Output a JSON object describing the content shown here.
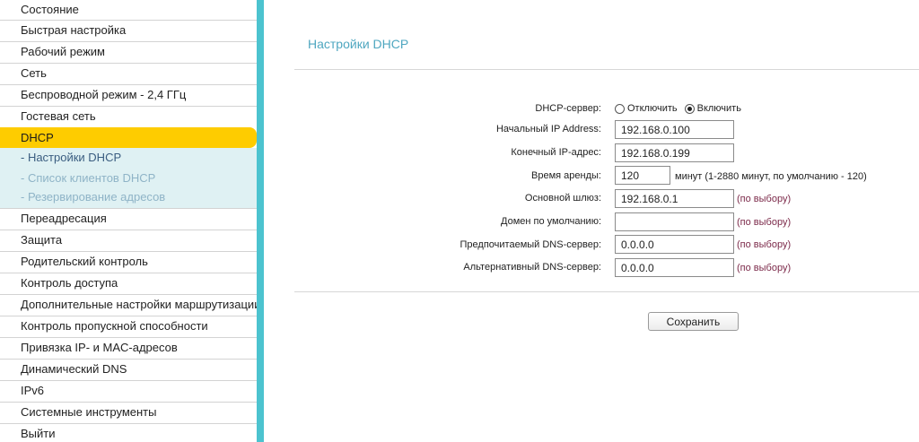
{
  "sidebar": {
    "items_top": [
      {
        "label": "Состояние"
      },
      {
        "label": "Быстрая настройка"
      },
      {
        "label": "Рабочий режим"
      },
      {
        "label": "Сеть"
      },
      {
        "label": "Беспроводной режим - 2,4 ГГц"
      },
      {
        "label": "Гостевая сеть"
      }
    ],
    "active_item": {
      "label": "DHCP"
    },
    "sub_items": [
      {
        "label": "- Настройки DHCP"
      },
      {
        "label": "- Список клиентов DHCP"
      },
      {
        "label": "- Резервирование адресов"
      }
    ],
    "items_bottom": [
      {
        "label": "Переадресация"
      },
      {
        "label": "Защита"
      },
      {
        "label": "Родительский контроль"
      },
      {
        "label": "Контроль доступа"
      },
      {
        "label": "Дополнительные настройки маршрутизации"
      },
      {
        "label": "Контроль пропускной способности"
      },
      {
        "label": "Привязка IP- и MAC-адресов"
      },
      {
        "label": "Динамический DNS"
      },
      {
        "label": "IPv6"
      },
      {
        "label": "Системные инструменты"
      },
      {
        "label": "Выйти"
      }
    ]
  },
  "main": {
    "title": "Настройки DHCP",
    "form": {
      "dhcp_server": {
        "label": "DHCP-сервер:",
        "options": [
          "Отключить",
          "Включить"
        ],
        "selected": "Включить"
      },
      "start_ip": {
        "label": "Начальный IP Address:",
        "value": "192.168.0.100"
      },
      "end_ip": {
        "label": "Конечный IP-адрес:",
        "value": "192.168.0.199"
      },
      "lease_time": {
        "label": "Время аренды:",
        "value": "120",
        "hint": "минут (1-2880 минут, по умолчанию - 120)"
      },
      "gateway": {
        "label": "Основной шлюз:",
        "value": "192.168.0.1",
        "note": "(по выбору)"
      },
      "domain": {
        "label": "Домен по умолчанию:",
        "value": "",
        "note": "(по выбору)"
      },
      "dns_primary": {
        "label": "Предпочитаемый DNS-сервер:",
        "value": "0.0.0.0",
        "note": "(по выбору)"
      },
      "dns_secondary": {
        "label": "Альтернативный DNS-сервер:",
        "value": "0.0.0.0",
        "note": "(по выбору)"
      }
    },
    "save_label": "Сохранить"
  },
  "colors": {
    "accent_teal": "#4cc3cf",
    "active_yellow": "#fecc00",
    "title_blue": "#4fa7c0",
    "note_maroon": "#7c2a4a"
  }
}
